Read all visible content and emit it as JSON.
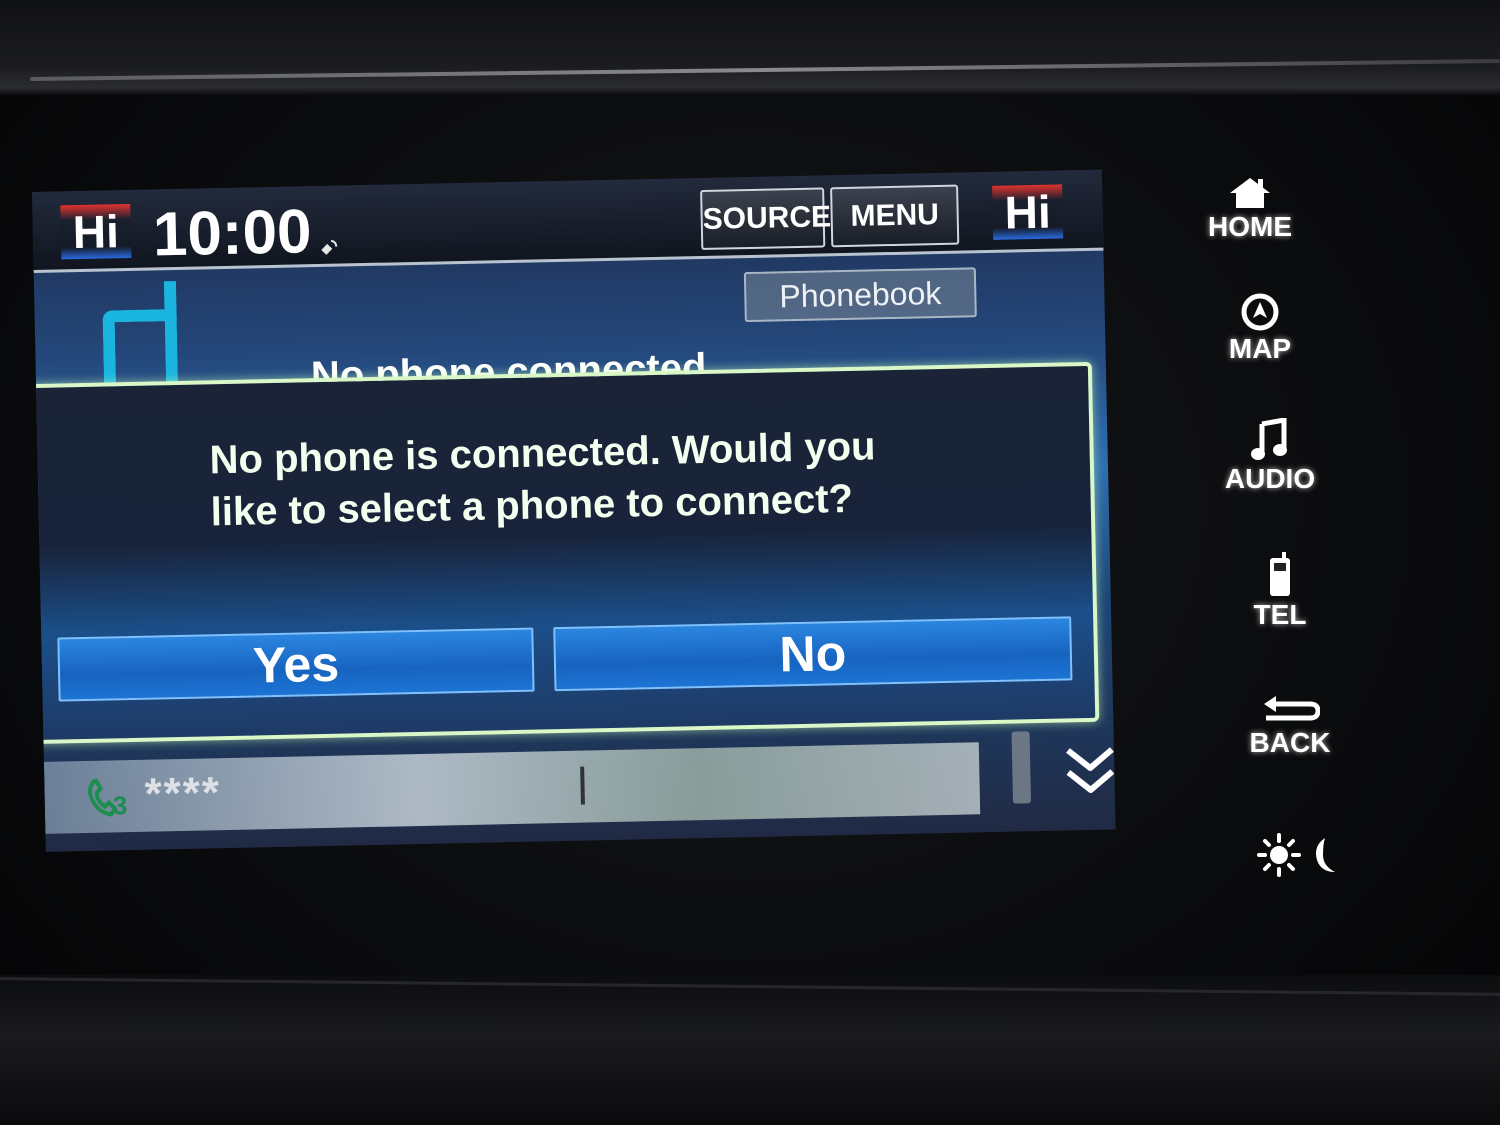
{
  "header": {
    "hi_badge_left": "Hi",
    "hi_badge_right": "Hi",
    "clock": "10:00",
    "source_label": "SOURCE",
    "menu_label": "MENU"
  },
  "phone_screen": {
    "phonebook_label": "Phonebook",
    "status_text": "No phone connected"
  },
  "dialog": {
    "message": "No phone is connected. Would you like to select a phone to connect?",
    "yes_label": "Yes",
    "no_label": "No"
  },
  "call_bar": {
    "call_count": "3",
    "masked_number": "****"
  },
  "side_buttons": {
    "home_label": "HOME",
    "map_label": "MAP",
    "audio_label": "AUDIO",
    "tel_label": "TEL",
    "back_label": "BACK"
  },
  "colors": {
    "accent_blue": "#1b6fd0",
    "dialog_border": "#d9f7c7",
    "phone_icon": "#1ab6e0",
    "call_green": "#1e9f4f"
  }
}
